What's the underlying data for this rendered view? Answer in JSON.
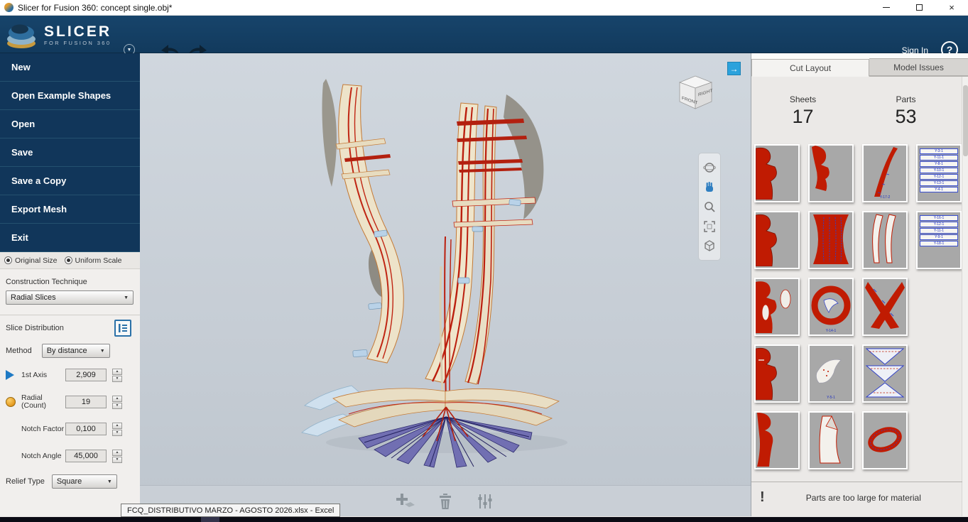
{
  "window": {
    "title": "Slicer for Fusion 360: concept single.obj*"
  },
  "icons": {
    "close": "×",
    "help": "?",
    "dropdown": "▼",
    "up": "▲",
    "down": "▼",
    "chevron": "▼",
    "expand": "→",
    "warning": "!"
  },
  "topbar": {
    "brand1": "SLICER",
    "brand2": "FOR FUSION 360",
    "sign_in": "Sign In"
  },
  "menu": {
    "items": [
      "New",
      "Open Example Shapes",
      "Open",
      "Save",
      "Save a Copy",
      "Export Mesh",
      "Exit"
    ]
  },
  "options": {
    "radio1": "Original Size",
    "radio2": "Uniform Scale"
  },
  "construction": {
    "label": "Construction Technique",
    "value": "Radial Slices"
  },
  "slice": {
    "label": "Slice Distribution",
    "method_label": "Method",
    "method_value": "By distance",
    "axis_label": "1st Axis",
    "axis_value": "2,909",
    "radial_label1": "Radial",
    "radial_label2": "(Count)",
    "radial_value": "19",
    "notch_factor_label": "Notch Factor",
    "notch_factor_value": "0,100",
    "notch_angle_label": "Notch Angle",
    "notch_angle_value": "45,000",
    "relief_label": "Relief Type",
    "relief_value": "Square"
  },
  "viewcube": {
    "front": "FRONT",
    "right": "RIGHT"
  },
  "panel": {
    "tab_cut": "Cut Layout",
    "tab_issues": "Model Issues",
    "sheets_label": "Sheets",
    "sheets_value": "17",
    "parts_label": "Parts",
    "parts_value": "53",
    "warning": "Parts are too large for material"
  },
  "sheets": {
    "stack_a": [
      "Y-3-1",
      "Y-11-1",
      "Y-8-1",
      "Y-10-1",
      "Y-12-1",
      "Y-13-1",
      "Y-4-1"
    ],
    "stack_b": [
      "Y-16-1",
      "Y-12-1",
      "Y-11-1",
      "Y-9-1",
      "Y-18-1"
    ],
    "tag_t3": "Y-17-2",
    "tag_t10": "Y-14-1",
    "tag_t13": "Y-5-1"
  },
  "taskbar": {
    "tooltip": "FCQ_DISTRIBUTIVO MARZO - AGOSTO 2026.xlsx - Excel"
  },
  "colors": {
    "navy": "#11365a",
    "red": "#c01b02",
    "panel": "#ebe9e7",
    "accent_blue": "#2ba2dc"
  }
}
